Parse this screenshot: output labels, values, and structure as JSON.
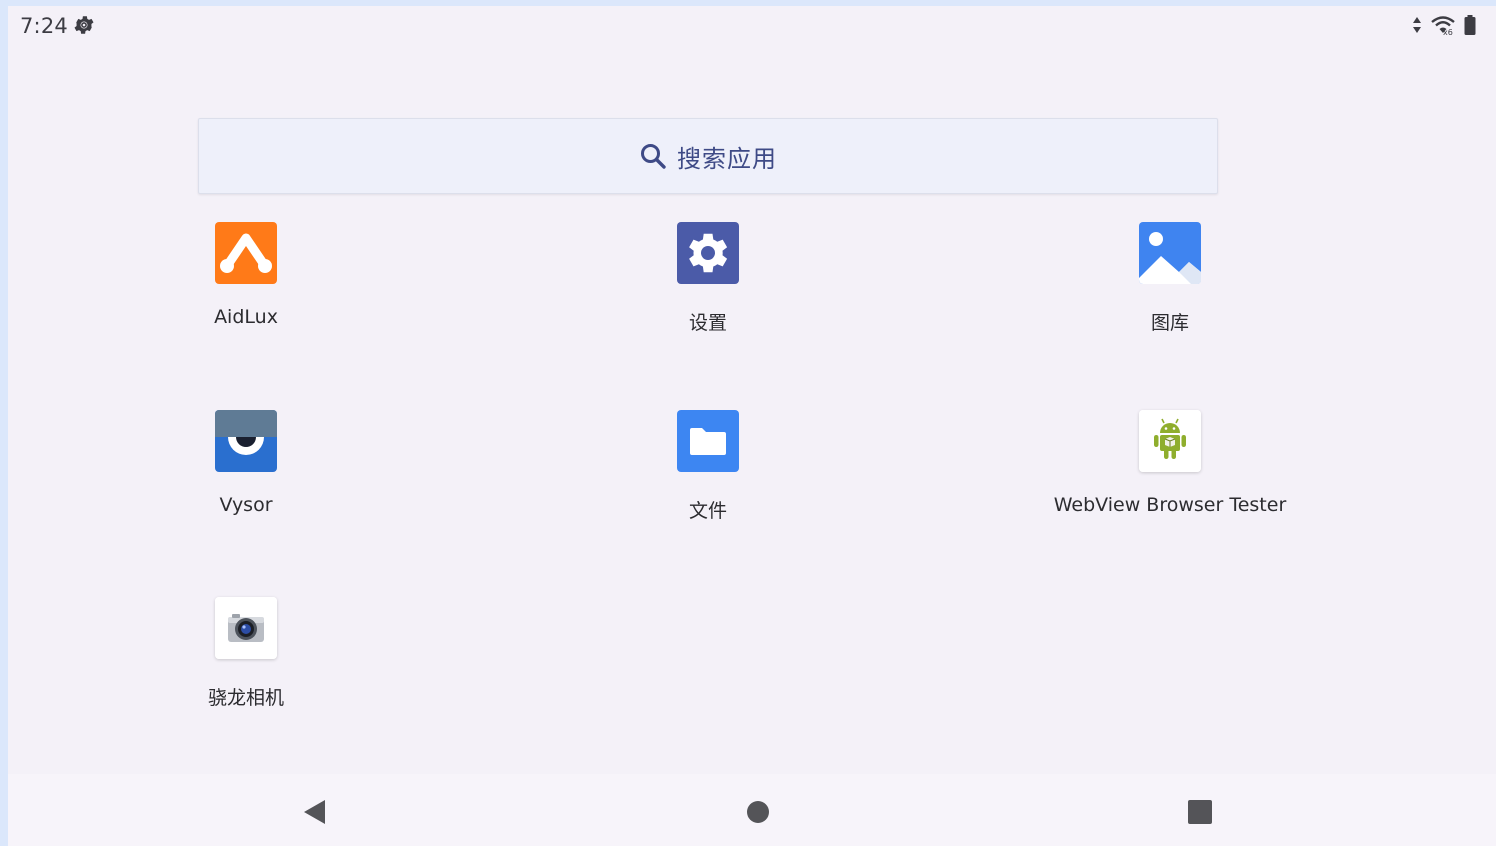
{
  "status_bar": {
    "time": "7:24",
    "left_icons": [
      "settings-gear-icon"
    ],
    "right_icons": [
      "data-arrows-icon",
      "wifi-no-internet-icon",
      "battery-icon"
    ],
    "wifi_badge": "x6"
  },
  "search": {
    "placeholder": "搜索应用"
  },
  "apps": [
    {
      "label": "AidLux",
      "icon": "aidlux-icon",
      "color": "#ff7a18"
    },
    {
      "label": "设置",
      "icon": "settings-icon",
      "color": "#4b5ba8"
    },
    {
      "label": "图库",
      "icon": "gallery-icon",
      "color": "#3f84f0"
    },
    {
      "label": "Vysor",
      "icon": "vysor-icon",
      "color": "#2a6fcf"
    },
    {
      "label": "文件",
      "icon": "files-icon",
      "color": "#3d86f2"
    },
    {
      "label": "WebView Browser Tester",
      "icon": "android-robot-icon",
      "color": "#8fae2d"
    },
    {
      "label": "骁龙相机",
      "icon": "camera-icon",
      "color": "#2c4da5"
    }
  ],
  "nav_bar": {
    "items": [
      "back-icon",
      "home-icon",
      "recents-icon"
    ]
  }
}
